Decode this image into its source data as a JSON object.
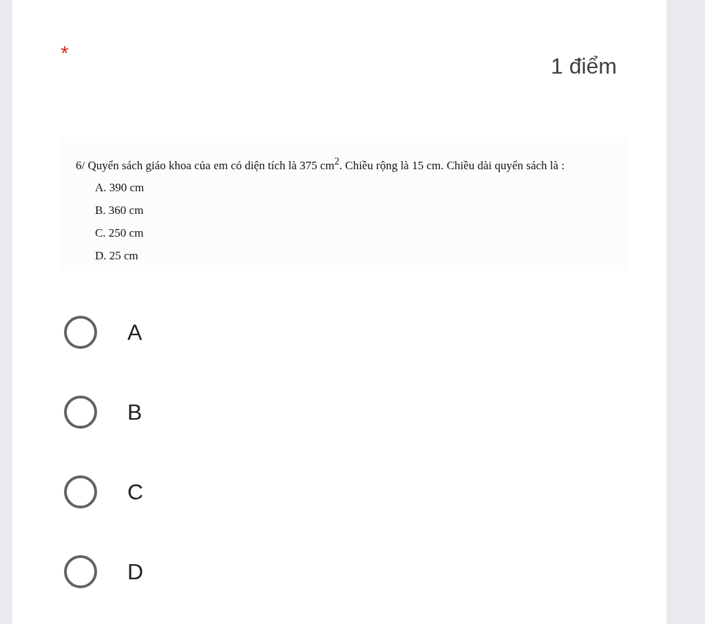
{
  "question": {
    "required_mark": "*",
    "points": "1 điểm",
    "image_text": {
      "stem": "6/ Quyển sách giáo khoa của em có diện tích là 375 cm$^{2}$. Chiều rộng là 15 cm. Chiều dài quyển sách là :",
      "choices": [
        "A. 390 cm",
        "B. 360 cm",
        "C. 250 cm",
        "D. 25 cm"
      ]
    }
  },
  "options": [
    {
      "label": "A",
      "selected": false
    },
    {
      "label": "B",
      "selected": false
    },
    {
      "label": "C",
      "selected": false
    },
    {
      "label": "D",
      "selected": false
    }
  ]
}
